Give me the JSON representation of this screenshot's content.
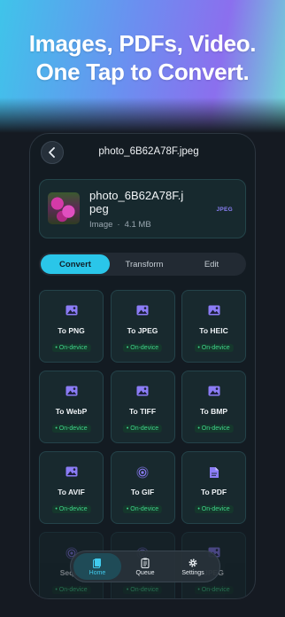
{
  "hero": {
    "line1": "Images, PDFs, Video.",
    "line2": "One Tap to Convert."
  },
  "nav": {
    "title": "photo_6B62A78F.jpeg",
    "back_icon": "chevron-left-icon"
  },
  "file": {
    "name": "photo_6B62A78F.jpeg",
    "name_line1": "photo_6B62A78F.j",
    "name_line2": "peg",
    "type": "Image",
    "size": "4.1 MB",
    "badge": "JPEG"
  },
  "segments": [
    {
      "label": "Convert",
      "active": true
    },
    {
      "label": "Transform",
      "active": false
    },
    {
      "label": "Edit",
      "active": false
    }
  ],
  "formats": [
    {
      "label": "To PNG",
      "icon": "image-icon",
      "tag": "On-device"
    },
    {
      "label": "To JPEG",
      "icon": "image-icon",
      "tag": "On-device"
    },
    {
      "label": "To HEIC",
      "icon": "image-icon",
      "tag": "On-device"
    },
    {
      "label": "To WebP",
      "icon": "image-icon",
      "tag": "On-device"
    },
    {
      "label": "To TIFF",
      "icon": "image-icon",
      "tag": "On-device"
    },
    {
      "label": "To BMP",
      "icon": "image-icon",
      "tag": "On-device"
    },
    {
      "label": "To AVIF",
      "icon": "image-icon",
      "tag": "On-device"
    },
    {
      "label": "To GIF",
      "icon": "gif-icon",
      "tag": "On-device"
    },
    {
      "label": "To PDF",
      "icon": "document-icon",
      "tag": "On-device"
    }
  ],
  "partial_row": [
    {
      "label": "Seque",
      "icon": "gif-icon",
      "tag": "On-device"
    },
    {
      "label": "",
      "icon": "gif-icon",
      "tag": "On-device"
    },
    {
      "label": "JPEG",
      "icon": "image-icon",
      "tag": "On-device"
    }
  ],
  "tabs": [
    {
      "label": "Home",
      "icon": "document-stack-icon",
      "active": true
    },
    {
      "label": "Queue",
      "icon": "clipboard-list-icon",
      "active": false
    },
    {
      "label": "Settings",
      "icon": "gear-icon",
      "active": false
    }
  ],
  "colors": {
    "accent": "#2ac6e9",
    "on_device": "#3fd48a",
    "icon_purple": "#8b7cf6"
  }
}
